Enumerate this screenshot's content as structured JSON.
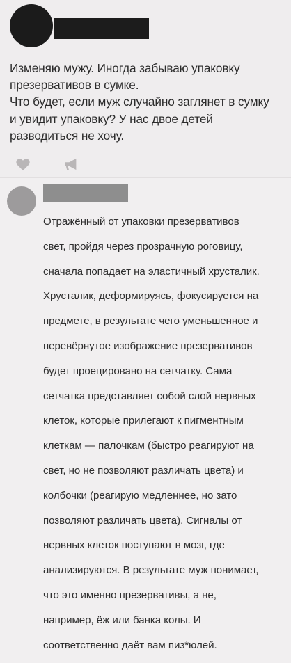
{
  "post": {
    "lines": [
      "Изменяю мужу. Иногда забываю упаковку",
      "презервативов в сумке.",
      "Что будет, если муж случайно заглянет в сумку",
      "и увидит упаковку? У нас двое детей",
      "разводиться не хочу."
    ],
    "icons": [
      "heart-icon",
      "megaphone-icon"
    ]
  },
  "comment": {
    "lines": [
      "Отражённый от упаковки презервативов",
      "свет, пройдя через прозрачную роговицу,",
      "сначала попадает на эластичный хрусталик.",
      "Хрусталик, деформируясь, фокусируется на",
      "предмете, в результате чего уменьшенное и",
      "перевёрнутое изображение презервативов",
      "будет проецировано на сетчатку. Сама",
      "сетчатка представляет собой слой нервных",
      "клеток, которые прилегают к пигментным",
      "клеткам — палочкам (быстро реагируют на",
      "свет, но не позволяют различать цвета) и",
      "колбочки (реагирую медленнее, но зато",
      "позволяют различать цвета). Сигналы от",
      "нервных клеток поступают в мозг, где",
      "анализируются. В результате муж понимает,",
      "что это именно презервативы, а не,",
      "например, ёж или банка колы. И",
      "соответственно даёт вам пиз*юлей."
    ]
  },
  "colors": {
    "background": "#f1eff0",
    "text": "#2b2b2b",
    "redaction": "#1c1c1c",
    "icon": "#b9b6b7"
  }
}
